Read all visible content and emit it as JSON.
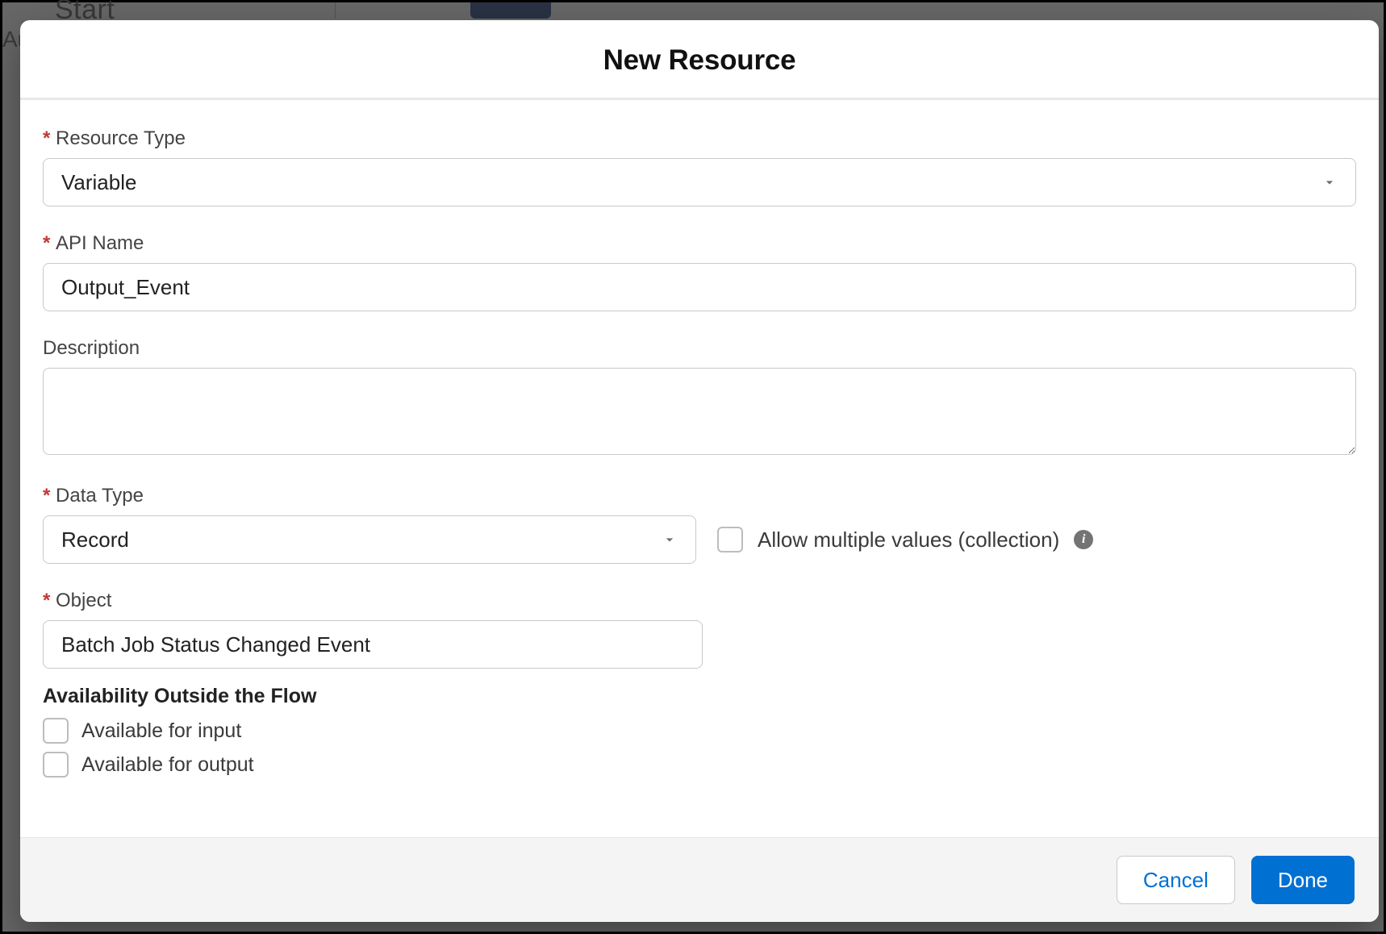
{
  "background": {
    "start_label": "Start",
    "truncated_text": "Au"
  },
  "modal": {
    "title": "New Resource",
    "fields": {
      "resource_type": {
        "label": "Resource Type",
        "value": "Variable"
      },
      "api_name": {
        "label": "API Name",
        "value": "Output_Event"
      },
      "description": {
        "label": "Description",
        "value": ""
      },
      "data_type": {
        "label": "Data Type",
        "value": "Record"
      },
      "allow_multiple": {
        "label": "Allow multiple values (collection)",
        "checked": false
      },
      "object": {
        "label": "Object",
        "value": "Batch Job Status Changed Event"
      }
    },
    "availability": {
      "heading": "Availability Outside the Flow",
      "input": {
        "label": "Available for input",
        "checked": false
      },
      "output": {
        "label": "Available for output",
        "checked": false
      }
    },
    "buttons": {
      "cancel": "Cancel",
      "done": "Done"
    }
  }
}
